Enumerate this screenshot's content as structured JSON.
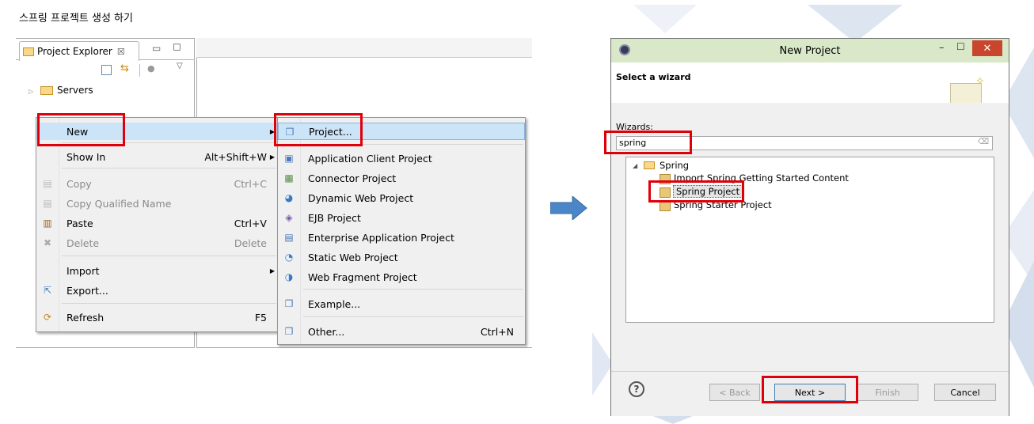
{
  "caption": "스프링 프로젝트 생성 하기",
  "project_explorer": {
    "tab_label": "Project Explorer",
    "tree_items": [
      {
        "label": "Servers"
      }
    ]
  },
  "context_menu": {
    "items": [
      {
        "label": "New",
        "shortcut": "",
        "submenu": true,
        "disabled": false
      },
      {
        "label": "Show In",
        "shortcut": "Alt+Shift+W",
        "submenu": true,
        "disabled": false
      },
      {
        "label": "Copy",
        "shortcut": "Ctrl+C",
        "submenu": false,
        "disabled": true
      },
      {
        "label": "Copy Qualified Name",
        "shortcut": "",
        "submenu": false,
        "disabled": true
      },
      {
        "label": "Paste",
        "shortcut": "Ctrl+V",
        "submenu": false,
        "disabled": false
      },
      {
        "label": "Delete",
        "shortcut": "Delete",
        "submenu": false,
        "disabled": true
      },
      {
        "label": "Import",
        "shortcut": "",
        "submenu": true,
        "disabled": false
      },
      {
        "label": "Export...",
        "shortcut": "",
        "submenu": false,
        "disabled": false
      },
      {
        "label": "Refresh",
        "shortcut": "F5",
        "submenu": false,
        "disabled": false
      }
    ]
  },
  "new_submenu": {
    "items": [
      {
        "label": "Project...",
        "shortcut": ""
      },
      {
        "label": "Application Client Project",
        "shortcut": ""
      },
      {
        "label": "Connector Project",
        "shortcut": ""
      },
      {
        "label": "Dynamic Web Project",
        "shortcut": ""
      },
      {
        "label": "EJB Project",
        "shortcut": ""
      },
      {
        "label": "Enterprise Application Project",
        "shortcut": ""
      },
      {
        "label": "Static Web Project",
        "shortcut": ""
      },
      {
        "label": "Web Fragment Project",
        "shortcut": ""
      },
      {
        "label": "Example...",
        "shortcut": ""
      },
      {
        "label": "Other...",
        "shortcut": "Ctrl+N"
      }
    ]
  },
  "dialog": {
    "title": "New Project",
    "header_title": "Select a wizard",
    "wizards_label": "Wizards:",
    "filter_value": "spring",
    "tree": {
      "folder": "Spring",
      "items": [
        {
          "label": "Import Spring Getting Started Content"
        },
        {
          "label": "Spring Project"
        },
        {
          "label": "Spring Starter Project"
        }
      ]
    },
    "buttons": {
      "back": "< Back",
      "next": "Next >",
      "finish": "Finish",
      "cancel": "Cancel"
    },
    "help_glyph": "?"
  },
  "colors": {
    "highlight": "#e0000a",
    "arrow": "#4a86c8",
    "title_bar": "#d8e8c8",
    "selection": "#cce4f7"
  }
}
